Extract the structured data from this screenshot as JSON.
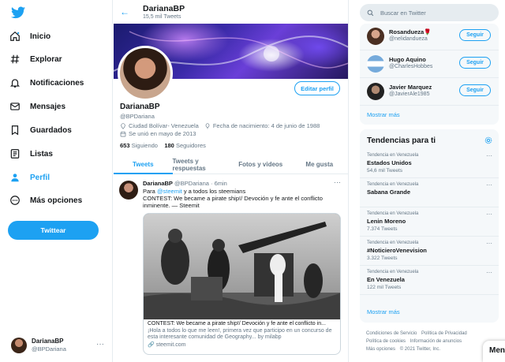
{
  "nav": {
    "items": [
      {
        "label": "Inicio",
        "icon": "home-icon"
      },
      {
        "label": "Explorar",
        "icon": "hashtag-icon"
      },
      {
        "label": "Notificaciones",
        "icon": "bell-icon"
      },
      {
        "label": "Mensajes",
        "icon": "mail-icon"
      },
      {
        "label": "Guardados",
        "icon": "bookmark-icon"
      },
      {
        "label": "Listas",
        "icon": "list-icon"
      },
      {
        "label": "Perfil",
        "icon": "person-icon"
      },
      {
        "label": "Más opciones",
        "icon": "more-circle-icon"
      }
    ],
    "tweet_button": "Twittear",
    "account": {
      "name": "DarianaBP",
      "handle": "@BPDariana"
    }
  },
  "header": {
    "name": "DarianaBP",
    "tweet_count": "15,5 mil Tweets"
  },
  "profile": {
    "edit_button": "Editar perfil",
    "name": "DarianaBP",
    "handle": "@BPDariana",
    "location": "Ciudad Bolívar- Venezuela",
    "birthday": "Fecha de nacimiento: 4 de junio de 1988",
    "joined": "Se unió en mayo de 2013",
    "following_count": "653",
    "following_label": "Siguiendo",
    "followers_count": "180",
    "followers_label": "Seguidores"
  },
  "tabs": [
    "Tweets",
    "Tweets y respuestas",
    "Fotos y videos",
    "Me gusta"
  ],
  "tweet": {
    "name": "DarianaBP",
    "handle_time": "@BPDariana · 6min",
    "text_prefix": "Para ",
    "mention": "@steemit",
    "text_suffix": " y a todos los steemians",
    "line2": "CONTEST: We became a pirate ship!/ Devoción y fe ante el conflicto",
    "line3": "inminente. — Steemit",
    "card_title": "CONTEST: We became a pirate ship!/ Devoción y fe ante el conflicto in...",
    "card_desc": "¡Hola a todos lo que me leen!, primera vez que participo en un concurso de esta interesante comunidad de Geography... by milabp",
    "card_domain": "steemit.com"
  },
  "search": {
    "placeholder": "Buscar en Twitter"
  },
  "who_to_follow": {
    "users": [
      {
        "name": "Rosandueza🌹",
        "handle": "@nelidandueza"
      },
      {
        "name": "Hugo Aquino",
        "handle": "@CharlesHobbes"
      },
      {
        "name": "Javier Marquez",
        "handle": "@JavierAle1985"
      }
    ],
    "follow_label": "Seguir",
    "show_more": "Mostrar más"
  },
  "trends": {
    "title": "Tendencias para ti",
    "items": [
      {
        "context": "Tendencia en Venezuela",
        "name": "Estados Unidos",
        "count": "54,6 mil Tweets"
      },
      {
        "context": "Tendencia en Venezuela",
        "name": "Sabana Grande",
        "count": ""
      },
      {
        "context": "Tendencia en Venezuela",
        "name": "Lenin Moreno",
        "count": "7.374 Tweets"
      },
      {
        "context": "Tendencia en Venezuela",
        "name": "#NoticieroVenevision",
        "count": "3.322 Tweets"
      },
      {
        "context": "Tendencia en Venezuela",
        "name": "En Venezuela",
        "count": "122 mil Tweets"
      }
    ],
    "show_more": "Mostrar más"
  },
  "footer": {
    "terms": "Condiciones de Servicio",
    "privacy": "Política de Privacidad",
    "cookies": "Política de cookies",
    "ads": "Información de anuncios",
    "more": "Más opciones",
    "copyright": "© 2021 Twitter, Inc."
  },
  "messages_tab": "Men",
  "colors": {
    "accent": "#1da1f2",
    "text": "#14171a",
    "secondary": "#657786"
  }
}
